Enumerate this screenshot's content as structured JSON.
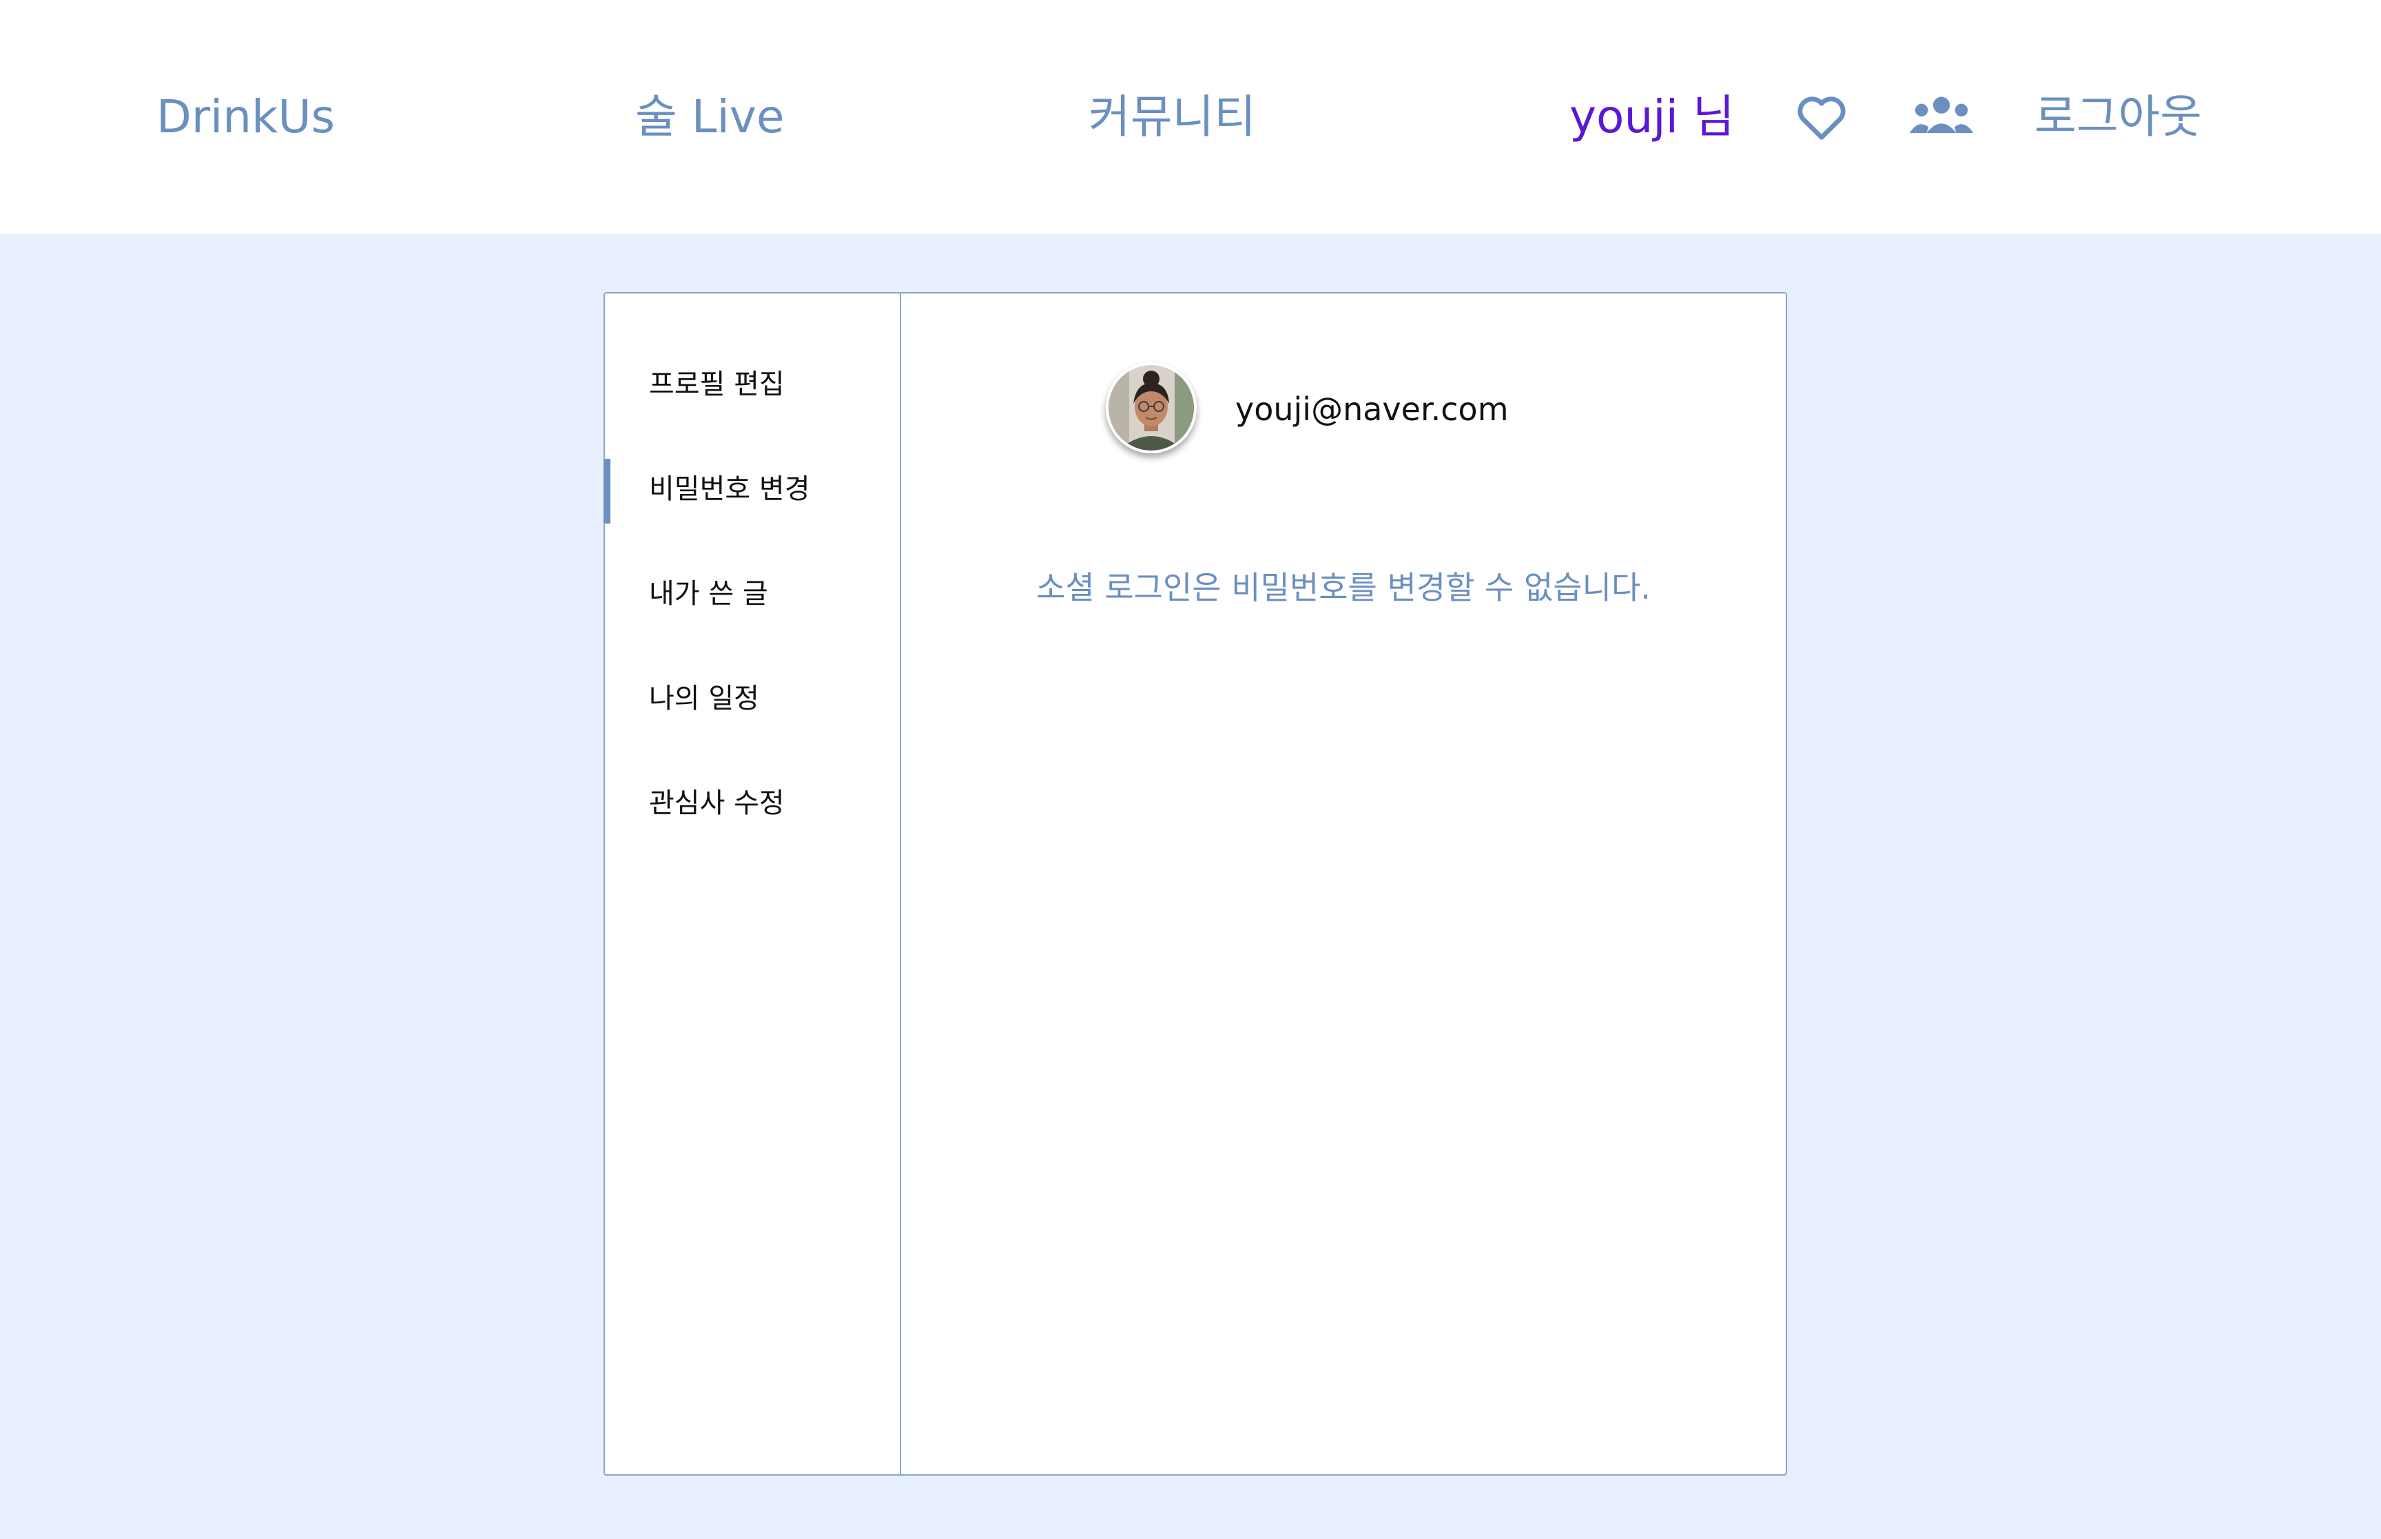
{
  "navbar": {
    "brand": "DrinkUs",
    "live": "술 Live",
    "community": "커뮤니티",
    "user_greeting": "youji 님",
    "logout": "로그아웃",
    "icons": [
      "heart-icon",
      "friends-icon"
    ]
  },
  "sidebar": {
    "items": [
      {
        "label": "프로필 편집"
      },
      {
        "label": "비밀번호 변경"
      },
      {
        "label": "내가 쓴 글"
      },
      {
        "label": "나의 일정"
      },
      {
        "label": "관심사 수정"
      }
    ],
    "active": "비밀번호 변경"
  },
  "profile": {
    "email": "youji@naver.com"
  },
  "password_section": {
    "notice": "소셜 로그인은 비밀번호를 변경할 수 없습니다."
  },
  "colors": {
    "accent": "#6a8fc0",
    "user": "#5b17d6",
    "background": "#e8f0fd",
    "border": "#8aa4c9"
  }
}
